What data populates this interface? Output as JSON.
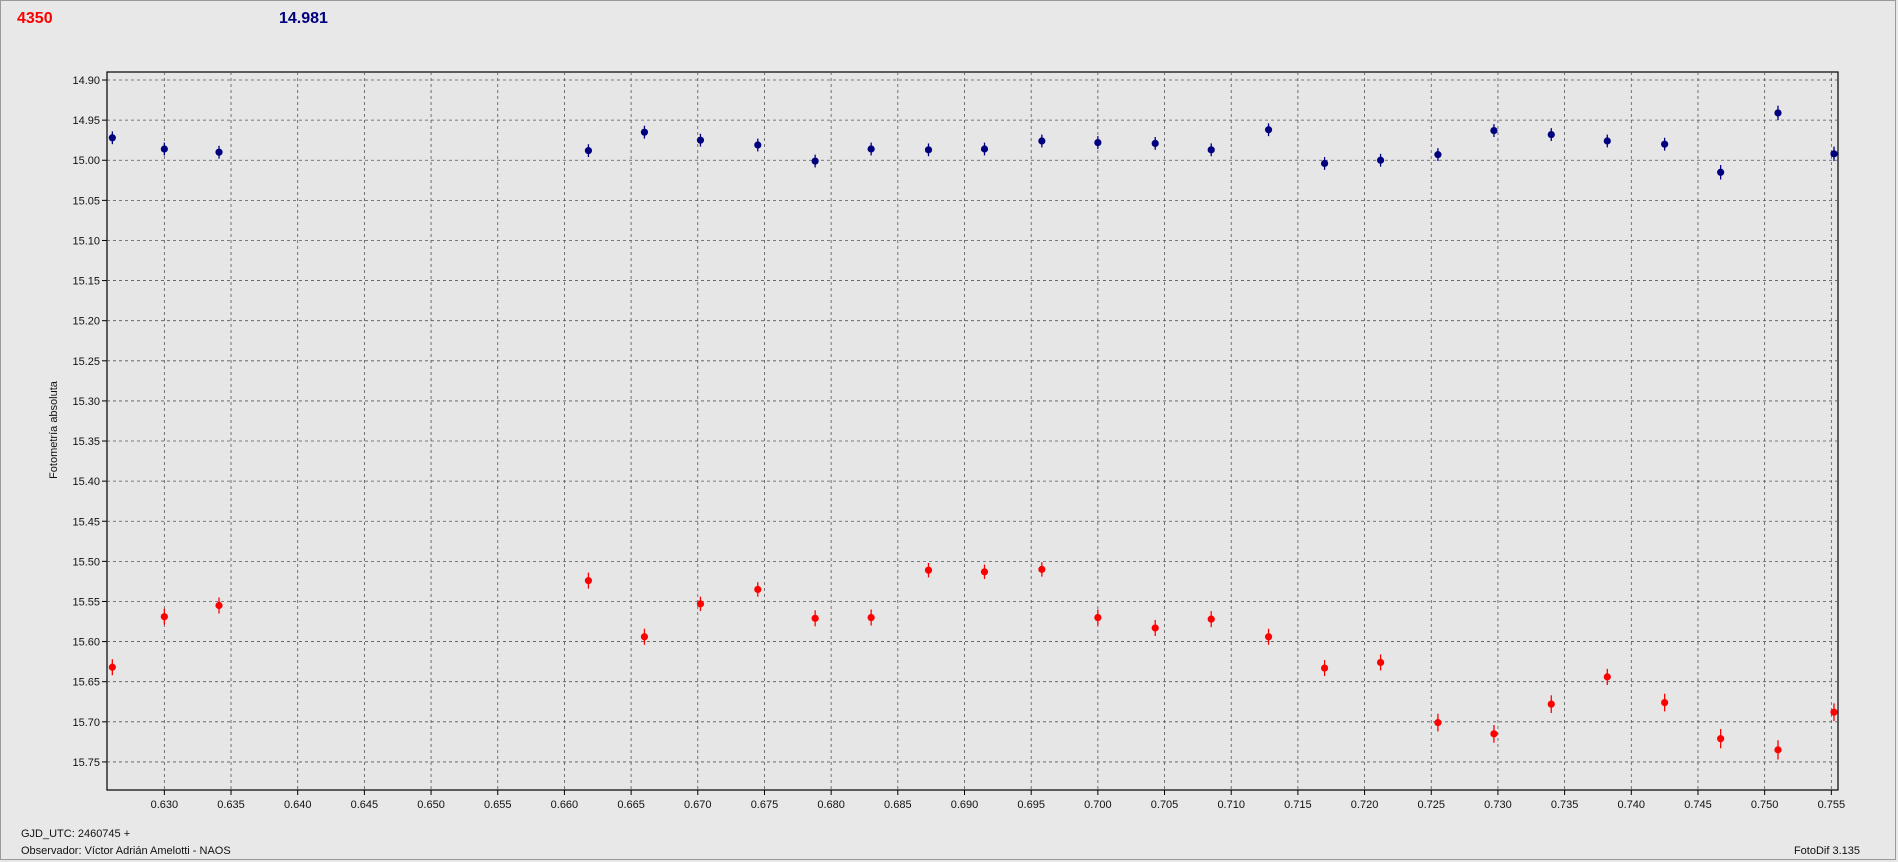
{
  "header": {
    "left_value": "4350",
    "left_color": "#ff0000",
    "right_value": "14.981",
    "right_color": "#00007f"
  },
  "footer": {
    "gjd_label": "GJD_UTC: 2460745 +",
    "observer": "Observador: Víctor Adrián Amelotti - NAOS",
    "version": "FotoDif 3.135"
  },
  "chart_data": {
    "type": "scatter",
    "ylabel": "Fotometría absoluta",
    "xlabel": "",
    "xlim": [
      0.6257,
      0.7555
    ],
    "ylim": [
      14.89,
      15.785
    ],
    "y_inverted": true,
    "grid": true,
    "x_ticks": [
      "0.630",
      "0.635",
      "0.640",
      "0.645",
      "0.650",
      "0.655",
      "0.660",
      "0.665",
      "0.670",
      "0.675",
      "0.680",
      "0.685",
      "0.690",
      "0.695",
      "0.700",
      "0.705",
      "0.710",
      "0.715",
      "0.720",
      "0.725",
      "0.730",
      "0.735",
      "0.740",
      "0.745",
      "0.750",
      "0.755"
    ],
    "y_ticks": [
      "14.90",
      "14.95",
      "15.00",
      "15.05",
      "15.10",
      "15.15",
      "15.20",
      "15.25",
      "15.30",
      "15.35",
      "15.40",
      "15.45",
      "15.50",
      "15.55",
      "15.60",
      "15.65",
      "15.70",
      "15.75"
    ],
    "series": [
      {
        "color": "#00007f",
        "x": [
          0.6261,
          0.63,
          0.6341,
          0.6618,
          0.666,
          0.6702,
          0.6745,
          0.6788,
          0.683,
          0.6873,
          0.6915,
          0.6958,
          0.7,
          0.7043,
          0.7085,
          0.7128,
          0.717,
          0.7212,
          0.7255,
          0.7297,
          0.734,
          0.7382,
          0.7425,
          0.7467,
          0.751,
          0.7552
        ],
        "y": [
          14.972,
          14.986,
          14.99,
          14.988,
          14.965,
          14.975,
          14.981,
          15.001,
          14.986,
          14.987,
          14.986,
          14.976,
          14.978,
          14.979,
          14.987,
          14.962,
          15.004,
          15.0,
          14.993,
          14.963,
          14.968,
          14.976,
          14.98,
          15.015,
          14.941,
          14.992
        ],
        "err": [
          0.008,
          0.008,
          0.008,
          0.008,
          0.008,
          0.008,
          0.008,
          0.008,
          0.008,
          0.008,
          0.008,
          0.008,
          0.008,
          0.008,
          0.008,
          0.008,
          0.008,
          0.008,
          0.008,
          0.008,
          0.008,
          0.008,
          0.008,
          0.009,
          0.009,
          0.009
        ]
      },
      {
        "color": "#ff0000",
        "x": [
          0.6261,
          0.63,
          0.6341,
          0.6618,
          0.666,
          0.6702,
          0.6745,
          0.6788,
          0.683,
          0.6873,
          0.6915,
          0.6958,
          0.7,
          0.7043,
          0.7085,
          0.7128,
          0.717,
          0.7212,
          0.7255,
          0.7297,
          0.734,
          0.7382,
          0.7425,
          0.7467,
          0.751,
          0.7552
        ],
        "y": [
          15.632,
          15.569,
          15.555,
          15.524,
          15.594,
          15.553,
          15.535,
          15.571,
          15.57,
          15.511,
          15.513,
          15.51,
          15.57,
          15.583,
          15.572,
          15.594,
          15.633,
          15.626,
          15.701,
          15.715,
          15.678,
          15.644,
          15.676,
          15.721,
          15.735,
          15.688
        ],
        "err": [
          0.01,
          0.01,
          0.01,
          0.01,
          0.01,
          0.009,
          0.009,
          0.01,
          0.01,
          0.009,
          0.009,
          0.009,
          0.01,
          0.01,
          0.01,
          0.01,
          0.01,
          0.01,
          0.011,
          0.011,
          0.011,
          0.01,
          0.011,
          0.012,
          0.012,
          0.011
        ]
      }
    ]
  }
}
